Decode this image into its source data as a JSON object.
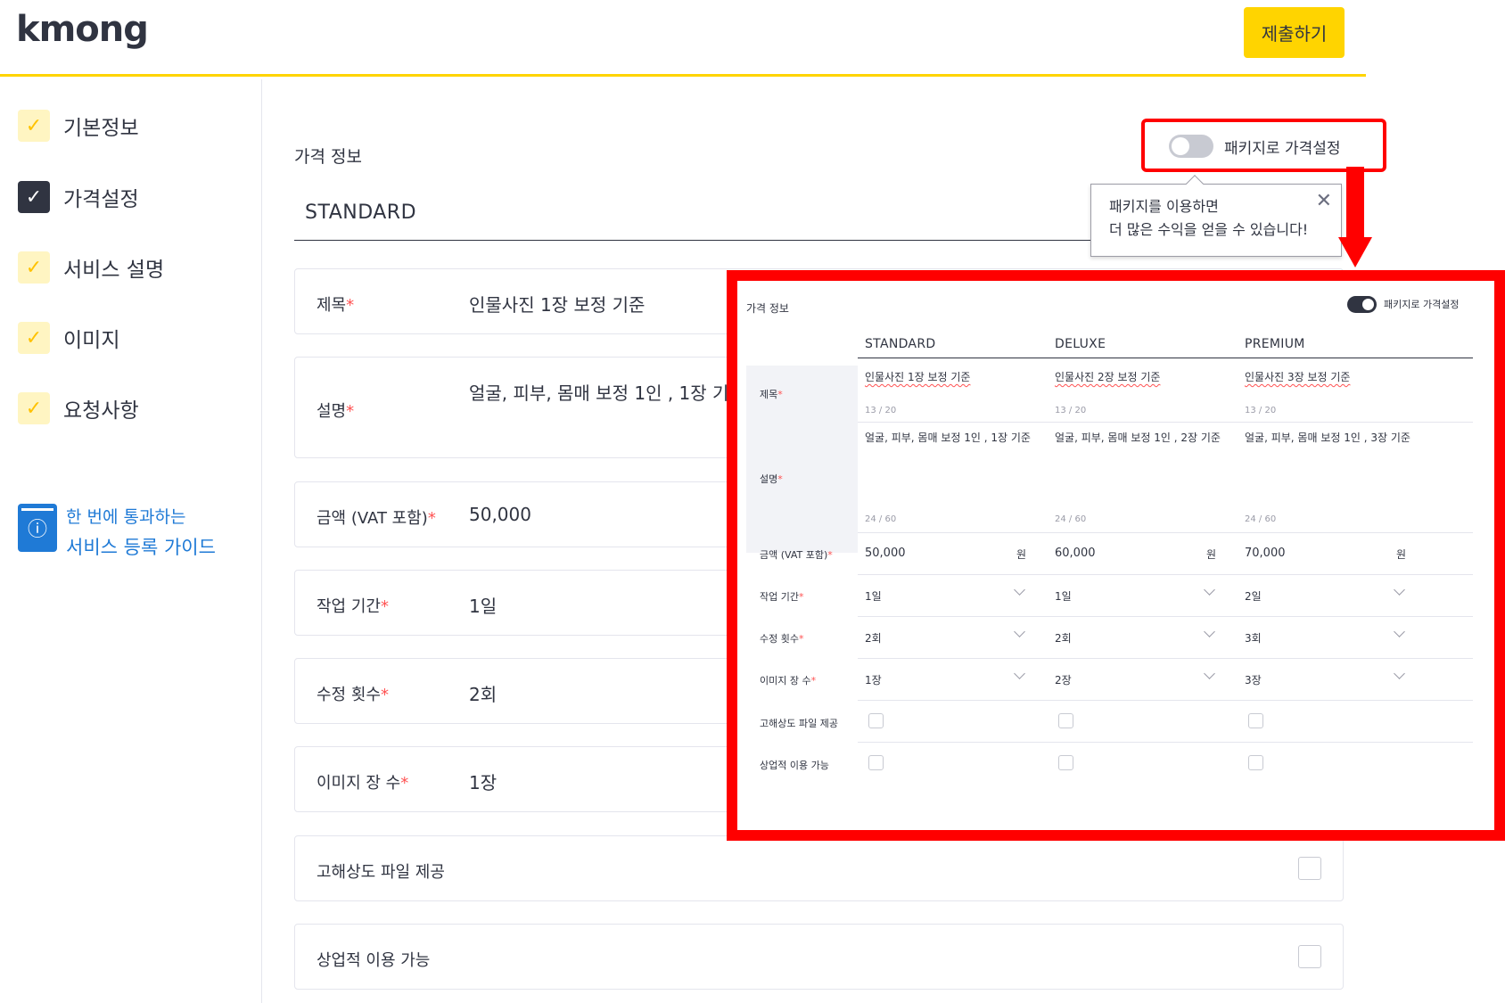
{
  "header": {
    "logo": "kmong",
    "submit_label": "제출하기"
  },
  "sidebar": {
    "steps": [
      {
        "label": "기본정보",
        "active": false
      },
      {
        "label": "가격설정",
        "active": true
      },
      {
        "label": "서비스 설명",
        "active": false
      },
      {
        "label": "이미지",
        "active": false
      },
      {
        "label": "요청사항",
        "active": false
      }
    ],
    "guide": {
      "line1": "한 번에 통과하는",
      "line2": "서비스 등록 가이드"
    }
  },
  "main": {
    "section_title": "가격 정보",
    "package_name": "STANDARD",
    "toggle_label": "패키지로 가격설정",
    "fields": [
      {
        "label": "제목",
        "required": "*",
        "value": "인물사진 1장 보정 기준"
      },
      {
        "label": "설명",
        "required": "*",
        "value": "얼굴, 피부, 몸매 보정 1인 , 1장 기준"
      },
      {
        "label": "금액 (VAT 포함)",
        "required": "*",
        "value": "50,000"
      },
      {
        "label": "작업 기간",
        "required": "*",
        "value": "1일"
      },
      {
        "label": "수정 횟수",
        "required": "*",
        "value": "2회"
      },
      {
        "label": "이미지 장 수",
        "required": "*",
        "value": "1장"
      },
      {
        "label": "고해상도 파일 제공",
        "required": "",
        "value": ""
      },
      {
        "label": "상업적 이용 가능",
        "required": "",
        "value": ""
      }
    ]
  },
  "tooltip": {
    "line1": "패키지를 이용하면",
    "line2": "더 많은 수익을 얻을 수 있습니다!",
    "close": "✕"
  },
  "package_panel": {
    "title": "가격 정보",
    "toggle_label": "패키지로 가격설정",
    "labels": {
      "title": "제목",
      "desc": "설명",
      "price": "금액 (VAT 포함)",
      "period": "작업 기간",
      "revisions": "수정 횟수",
      "images": "이미지 장 수",
      "hires": "고해상도 파일 제공",
      "commercial": "상업적 이용 가능",
      "req": "*"
    },
    "won": "원",
    "columns": [
      {
        "name": "STANDARD",
        "title": "인물사진 1장 보정 기준",
        "title_count": "13 / 20",
        "desc": "얼굴, 피부, 몸매 보정 1인 , 1장 기준",
        "desc_count": "24 / 60",
        "price": "50,000",
        "period": "1일",
        "revisions": "2회",
        "images": "1장"
      },
      {
        "name": "DELUXE",
        "title": "인물사진 2장 보정 기준",
        "title_count": "13 / 20",
        "desc": "얼굴, 피부, 몸매 보정 1인 , 2장 기준",
        "desc_count": "24 / 60",
        "price": "60,000",
        "period": "1일",
        "revisions": "2회",
        "images": "2장"
      },
      {
        "name": "PREMIUM",
        "title": "인물사진 3장 보정 기준",
        "title_count": "13 / 20",
        "desc": "얼굴, 피부, 몸매 보정 1인 , 3장 기준",
        "desc_count": "24 / 60",
        "price": "70,000",
        "period": "2일",
        "revisions": "3회",
        "images": "3장"
      }
    ]
  },
  "colors": {
    "accent": "#ffd400",
    "highlight": "#ff0000",
    "link": "#1f7ad6",
    "text": "#303441"
  }
}
